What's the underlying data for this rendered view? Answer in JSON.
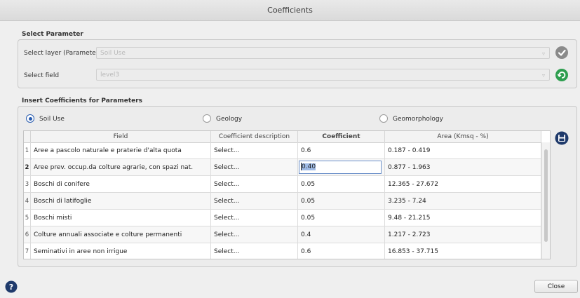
{
  "window": {
    "title": "Coefficients"
  },
  "select_parameter": {
    "title": "Select Parameter",
    "layer_label": "Select layer (Parameter)",
    "layer_value": "Soil Use",
    "field_label": "Select field",
    "field_value": "level3",
    "arrow": "▿",
    "confirm_icon": "check-icon",
    "reset_icon": "undo-icon"
  },
  "insert_coefficients": {
    "title": "Insert Coefficients for Parameters",
    "radios": [
      {
        "label": "Soil Use",
        "selected": true
      },
      {
        "label": "Geology",
        "selected": false
      },
      {
        "label": "Geomorphology",
        "selected": false
      }
    ],
    "columns": [
      "Field",
      "Coefficient description",
      "Coefficient",
      "Area (Kmsq - %)"
    ],
    "rows": [
      {
        "num": "1",
        "field": "Aree a pascolo naturale e praterie d'alta quota",
        "description": "Select...",
        "coefficient": "0.6",
        "area": "0.187 - 0.419"
      },
      {
        "num": "2",
        "field": "Aree prev. occup.da colture agrarie, con spazi nat.",
        "description": "Select...",
        "coefficient": "0.40",
        "area": "0.877 - 1.963"
      },
      {
        "num": "3",
        "field": "Boschi di conifere",
        "description": "Select...",
        "coefficient": "0.05",
        "area": "12.365 - 27.672"
      },
      {
        "num": "4",
        "field": "Boschi di latifoglie",
        "description": "Select...",
        "coefficient": "0.05",
        "area": "3.235 - 7.24"
      },
      {
        "num": "5",
        "field": "Boschi misti",
        "description": "Select...",
        "coefficient": "0.05",
        "area": "9.48 - 21.215"
      },
      {
        "num": "6",
        "field": "Colture annuali associate e colture permanenti",
        "description": "Select...",
        "coefficient": "0.4",
        "area": "1.217 - 2.723"
      },
      {
        "num": "7",
        "field": "Seminativi in aree non irrigue",
        "description": "Select...",
        "coefficient": "0.6",
        "area": "16.853 - 37.715"
      }
    ],
    "save_icon": "save-icon"
  },
  "footer": {
    "help_icon": "help-icon",
    "close_label": "Close"
  },
  "colors": {
    "green": "#4caf50",
    "blue_dark": "#1f3a6b",
    "check_gray": "#8a8a8a"
  }
}
